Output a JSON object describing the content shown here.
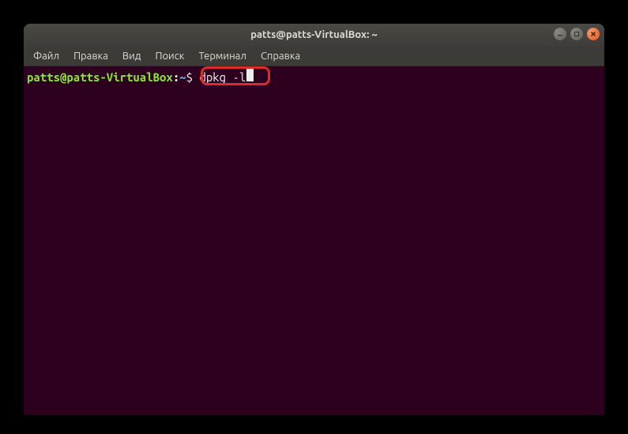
{
  "window": {
    "title": "patts@patts-VirtualBox: ~"
  },
  "menubar": {
    "items": [
      {
        "label": "Файл"
      },
      {
        "label": "Правка"
      },
      {
        "label": "Вид"
      },
      {
        "label": "Поиск"
      },
      {
        "label": "Терминал"
      },
      {
        "label": "Справка"
      }
    ]
  },
  "terminal": {
    "prompt_user": "patts@patts-VirtualBox",
    "prompt_colon": ":",
    "prompt_path": "~",
    "prompt_dollar": "$ ",
    "command": "dpkg -l"
  }
}
